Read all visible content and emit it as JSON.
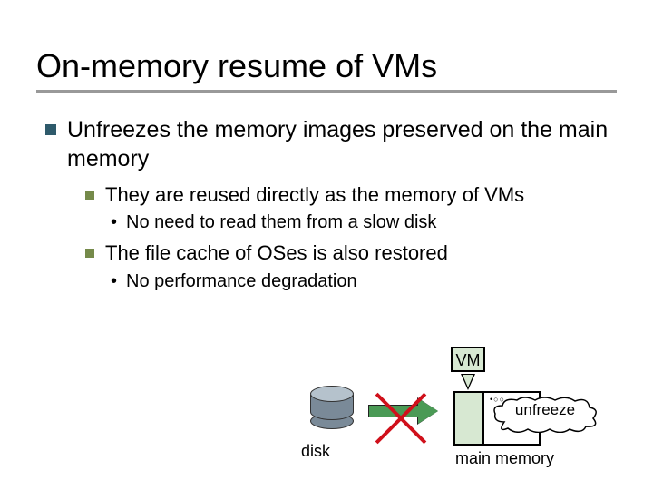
{
  "title": "On-memory resume of VMs",
  "bullet1": "Unfreezes the memory images preserved on the main memory",
  "sub1": "They are reused directly as the memory of VMs",
  "sub1a": "No need to read them from a slow disk",
  "sub2": "The file cache of OSes is also restored",
  "sub2a": "No performance degradation",
  "diagram": {
    "disk_label": "disk",
    "vm_label": "VM",
    "memory_label": "main memory",
    "cloud_label": "unfreeze"
  }
}
